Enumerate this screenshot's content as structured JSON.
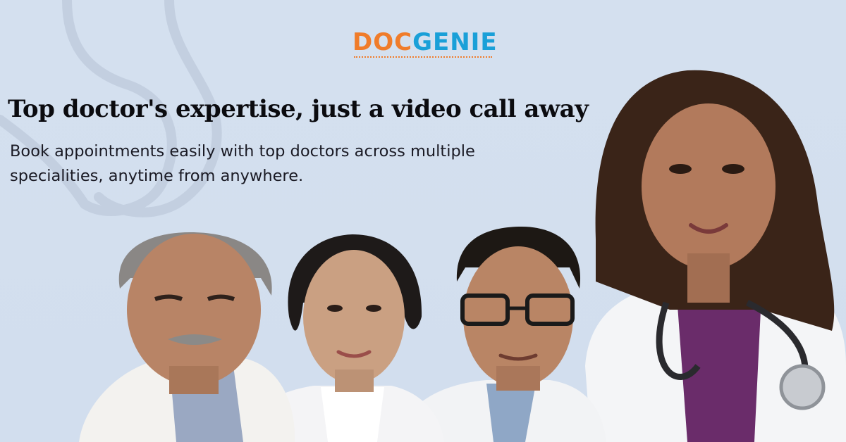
{
  "brand": {
    "logo_part1": "DOC",
    "logo_part2": "GENIE",
    "color_primary": "#f07c2a",
    "color_secondary": "#1aa0d8"
  },
  "hero": {
    "headline": "Top doctor's expertise, just a video call away",
    "subtext": "Book appointments easily with top doctors across multiple specialities, anytime from anywhere."
  },
  "doctors": [
    {
      "description": "photo-senior-male-doctor"
    },
    {
      "description": "photo-female-doctor-short-hair"
    },
    {
      "description": "photo-male-doctor-glasses"
    },
    {
      "description": "photo-female-doctor-stethoscope"
    }
  ],
  "background_color": "#d3dfef"
}
